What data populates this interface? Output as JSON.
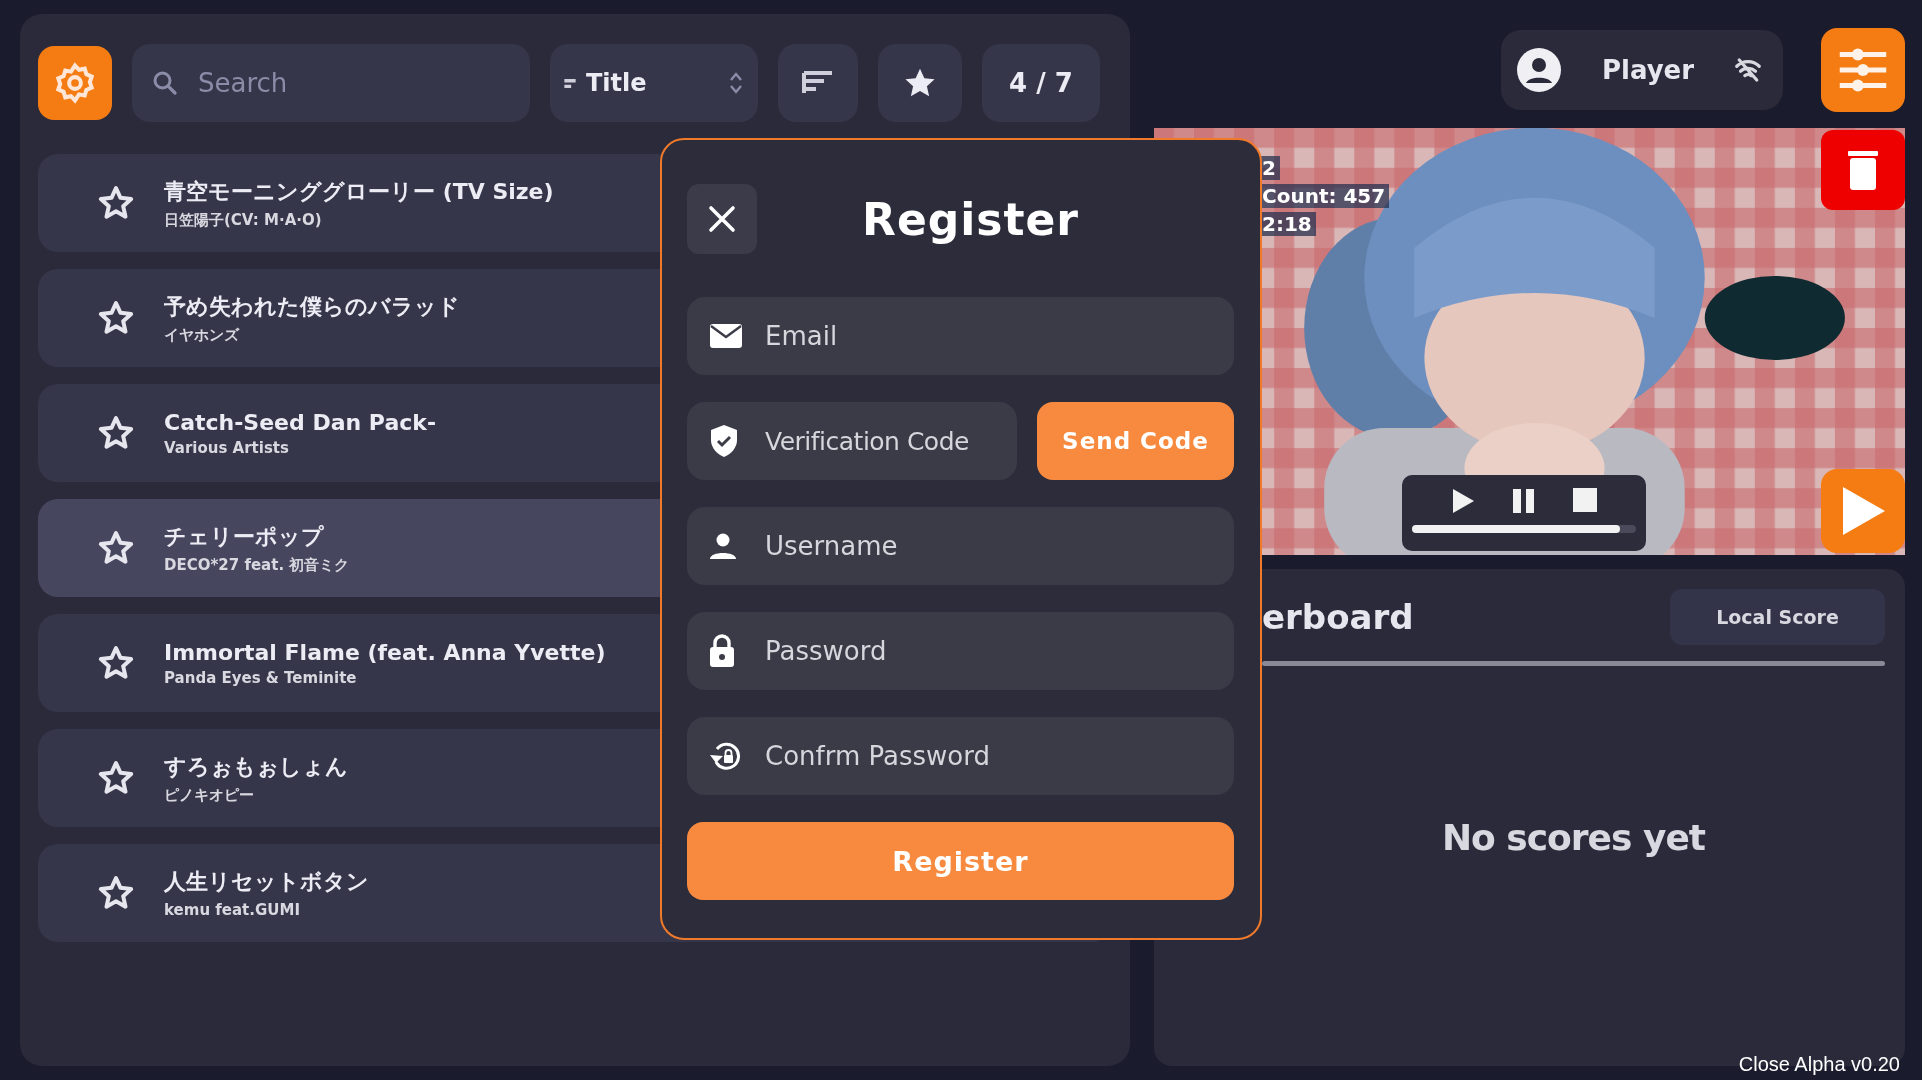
{
  "toolbar": {
    "search": {
      "placeholder": "Search"
    },
    "sort": {
      "label": "Title"
    },
    "count": "4 / 7"
  },
  "songs": [
    {
      "title": "青空モーニンググローリー (TV Size)",
      "artist": "日笠陽子(CV: M·A·O)",
      "selected": false
    },
    {
      "title": "予め失われた僕らのバラッド",
      "artist": "イヤホンズ",
      "selected": false
    },
    {
      "title": "Catch-Seed Dan Pack-",
      "artist": "Various Artists",
      "selected": false
    },
    {
      "title": "チェリーポップ",
      "artist": "DECO*27 feat. 初音ミク",
      "selected": true
    },
    {
      "title": "Immortal Flame (feat. Anna Yvette)",
      "artist": "Panda Eyes & Teminite",
      "selected": false
    },
    {
      "title": "すろぉもぉしょん",
      "artist": "ピノキオピー",
      "selected": false
    },
    {
      "title": "人生リセットボタン",
      "artist": "kemu feat.GUMI",
      "selected": false
    }
  ],
  "player": {
    "name": "Player"
  },
  "video": {
    "overlay_lines": [
      "2",
      "Count: 457",
      "2:18"
    ],
    "progress": {
      "level": 0.93
    }
  },
  "leaderboard": {
    "title": "erboard",
    "scope": "Local Score",
    "empty": "No scores yet"
  },
  "dialog": {
    "title": "Register",
    "fields": [
      {
        "kind": "email",
        "placeholder": "Email"
      },
      {
        "kind": "code",
        "placeholder": "Verification Code"
      },
      {
        "kind": "user",
        "placeholder": "Username"
      },
      {
        "kind": "lock",
        "placeholder": "Password"
      },
      {
        "kind": "confirm",
        "placeholder": "Confrm Password"
      }
    ],
    "send_button": "Send Code",
    "submit": "Register"
  },
  "version": "Close Alpha v0.20"
}
